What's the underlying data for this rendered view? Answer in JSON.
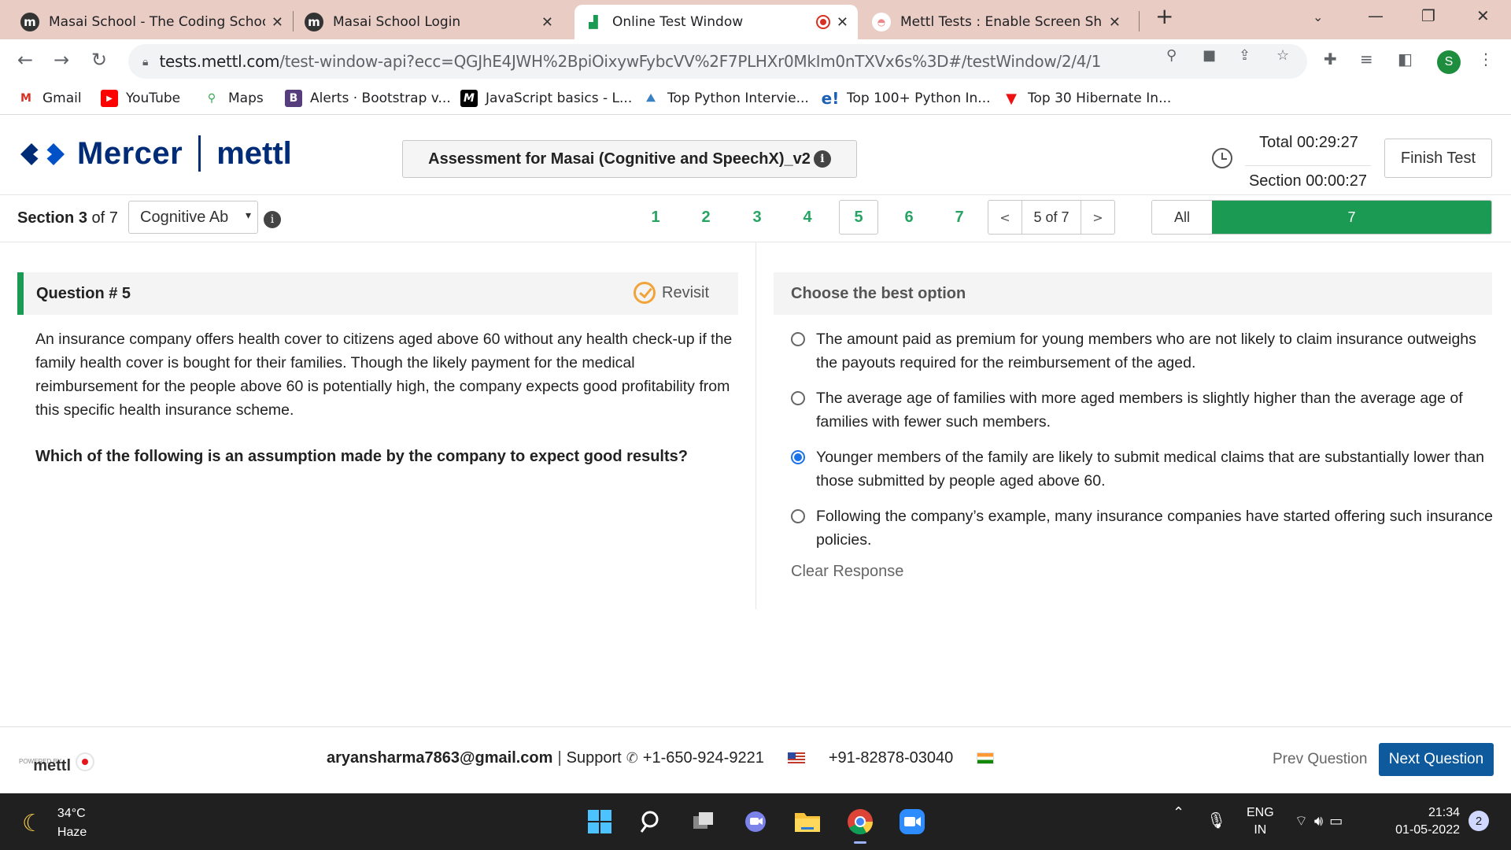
{
  "browser": {
    "tabs": [
      {
        "title": "Masai School - The Coding School",
        "favicon": "masai-logo",
        "active": false
      },
      {
        "title": "Masai School Login",
        "favicon": "masai-logo",
        "active": false
      },
      {
        "title": "Online Test Window",
        "favicon": "mettl-logo",
        "active": true,
        "recording": true
      },
      {
        "title": "Mettl Tests : Enable Screen Sharing",
        "favicon": "mettl-help-logo",
        "active": false
      }
    ],
    "url_host": "tests.mettl.com",
    "url_path": "/test-window-api?ecc=QGJhE4JWH%2BpiOixywFybcVV%2F7PLHXr0MkIm0nTXVx6s%3D#/testWindow/2/4/1",
    "profile_initial": "S",
    "bookmarks": [
      {
        "label": "Gmail",
        "icon": "gmail-icon"
      },
      {
        "label": "YouTube",
        "icon": "youtube-icon"
      },
      {
        "label": "Maps",
        "icon": "maps-icon"
      },
      {
        "label": "Alerts · Bootstrap v...",
        "icon": "bootstrap-icon"
      },
      {
        "label": "JavaScript basics - L...",
        "icon": "mdn-icon"
      },
      {
        "label": "Top Python Intervie...",
        "icon": "python-site-icon"
      },
      {
        "label": "Top 100+ Python In...",
        "icon": "e-icon"
      },
      {
        "label": "Top 30 Hibernate In...",
        "icon": "v-icon"
      }
    ]
  },
  "header": {
    "brand_left": "Mercer",
    "brand_right": "mettl",
    "assessment_title": "Assessment for Masai (Cognitive and SpeechX)_v2",
    "timer_total": "Total 00:29:27",
    "timer_section": "Section 00:00:27",
    "finish_label": "Finish Test"
  },
  "section_bar": {
    "section_word": "Section",
    "section_current": "3",
    "section_of": "of 7",
    "section_select_value": "Cognitive Ab",
    "question_numbers": [
      "1",
      "2",
      "3",
      "4",
      "5",
      "6",
      "7"
    ],
    "current_question": "5",
    "pager_prev": "<",
    "pager_text": "5 of 7",
    "pager_next": ">",
    "filter_all": "All",
    "filter_count": "7"
  },
  "question": {
    "title": "Question # 5",
    "revisit_label": "Revisit",
    "body": "An insurance company offers health cover to citizens aged above 60 without any health check-up if the family health cover is bought for their families. Though the likely payment for the medical reimbursement for the people above 60 is potentially high, the company expects good profitability from this specific health insurance scheme.",
    "prompt": "Which of the following is an assumption made by the company to expect good results?"
  },
  "options": {
    "title": "Choose the best option",
    "items": [
      {
        "text": "The amount paid as premium for young members who are not likely to claim insurance outweighs the payouts required for the reimbursement of the aged.",
        "selected": false
      },
      {
        "text": "The average age of families with more aged members is slightly higher than the average age of families with fewer such members.",
        "selected": false
      },
      {
        "text": "Younger members of the family are likely to submit medical claims that are substantially lower than those submitted by people aged above 60.",
        "selected": true
      },
      {
        "text": "Following the company’s example, many insurance companies have started offering such insurance policies.",
        "selected": false
      }
    ],
    "clear_label": "Clear Response"
  },
  "footer": {
    "powered_by": "POWERED BY",
    "powered_brand": "mettl",
    "email": "aryansharma7863@gmail.com",
    "support_label": "Support",
    "phone_us": "+1-650-924-9221",
    "phone_in": "+91-82878-03040",
    "prev_label": "Prev Question",
    "next_label": "Next Question"
  },
  "taskbar": {
    "temperature": "34°C",
    "weather": "Haze",
    "lang_top": "ENG",
    "lang_bottom": "IN",
    "time": "21:34",
    "date": "01-05-2022",
    "notifications": "2"
  },
  "colors": {
    "accent_green": "#1a9a52",
    "primary_blue": "#0f5a9c",
    "brand_navy": "#002c77"
  }
}
